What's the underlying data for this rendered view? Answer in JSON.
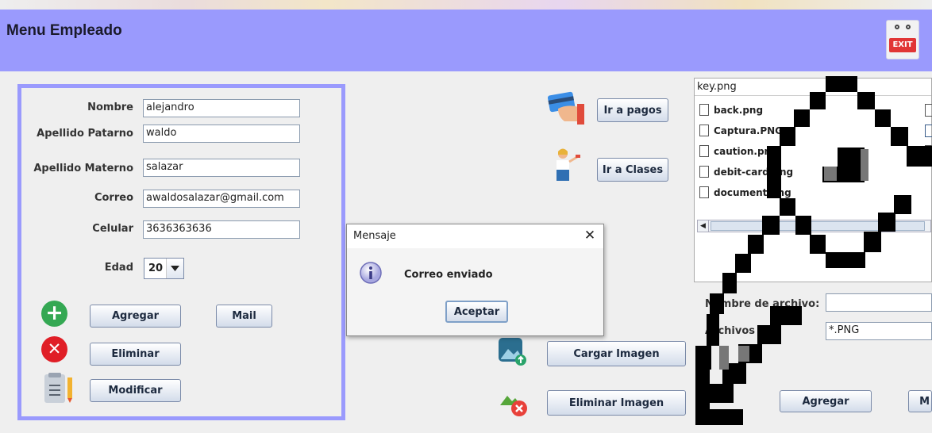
{
  "header": {
    "title": "Menu Empleado",
    "exit_label": "EXIT"
  },
  "form": {
    "nombre": {
      "label": "Nombre",
      "value": "alejandro"
    },
    "apellido_paterno": {
      "label": "Apellido Patarno",
      "value": "waldo"
    },
    "apellido_materno": {
      "label": "Apellido Materno",
      "value": "salazar"
    },
    "correo": {
      "label": "Correo",
      "value": "awaldosalazar@gmail.com"
    },
    "celular": {
      "label": "Celular",
      "value": "3636363636"
    },
    "edad": {
      "label": "Edad",
      "value": "20"
    },
    "buttons": {
      "agregar": "Agregar",
      "mail": "Mail",
      "eliminar": "Eliminar",
      "modificar": "Modificar"
    }
  },
  "actions": {
    "ir_pagos": "Ir a pagos",
    "ir_clases": "Ir a Clases",
    "cargar_imagen": "Cargar Imagen",
    "eliminar_imagen": "Eliminar Imagen"
  },
  "file_chooser": {
    "path": "key.png",
    "files": [
      "back.png",
      "Captura.PNG",
      "caution.png",
      "debit-card.png",
      "document.png"
    ],
    "filename_label": "Nombre de archivo:",
    "filetype_label": "Archivos de",
    "filetype_value": "*.PNG",
    "agregar": "Agregar",
    "partial_button": "M"
  },
  "dialog": {
    "title": "Mensaje",
    "message": "Correo enviado",
    "ok_label": "Aceptar",
    "close_glyph": "✕"
  },
  "colors": {
    "header": "#9a9afd",
    "panel_border": "#9a9afd",
    "add_icon": "#34a853",
    "delete_icon": "#e01e26"
  }
}
